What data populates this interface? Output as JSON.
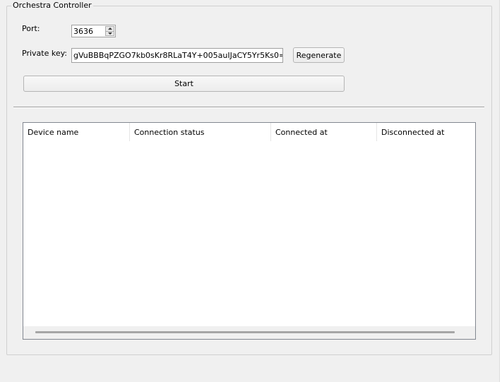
{
  "group": {
    "title": "Orchestra Controller"
  },
  "port": {
    "label": "Port:",
    "value": "3636"
  },
  "key": {
    "label": "Private key:",
    "value": "gVuBBBqPZGO7kb0sKr8RLaT4Y+005auIJaCY5Yr5Ks0="
  },
  "buttons": {
    "regenerate": "Regenerate",
    "start": "Start"
  },
  "table": {
    "columns": [
      "Device name",
      "Connection status",
      "Connected at",
      "Disconnected at"
    ],
    "rows": []
  }
}
